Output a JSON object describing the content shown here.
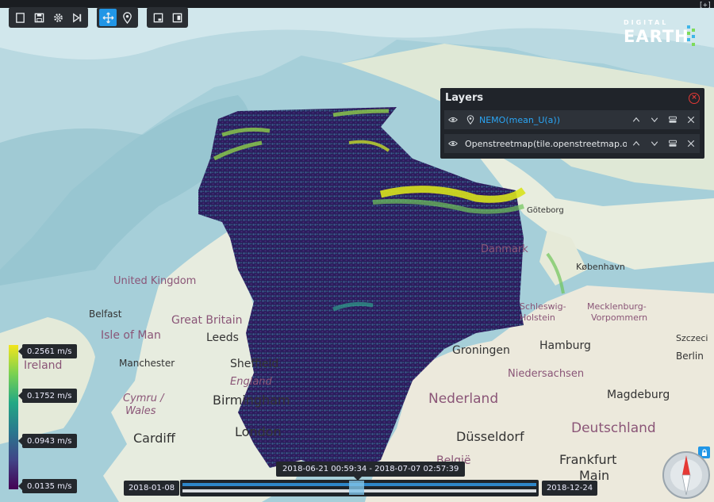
{
  "toolbar": {
    "left_group": [
      "new-file-icon",
      "save-icon",
      "settings-icon",
      "play-step-icon"
    ],
    "mid_group": [
      "pan-icon",
      "location-pin-icon"
    ],
    "right_group": [
      "window-icon",
      "window-expand-icon"
    ],
    "active": "pan-icon",
    "active_color": "#2196e6"
  },
  "brand": {
    "top": "DIGITAL",
    "main": "EARTH"
  },
  "fullscreen": "[+]",
  "layers": {
    "title": "Layers",
    "items": [
      {
        "name": "NEMO(mean_U(a))",
        "selected": true
      },
      {
        "name": "Openstreetmap(tile.openstreetmap.or",
        "selected": false
      }
    ]
  },
  "legend": {
    "values": [
      "0.2561 m/s",
      "0.1752 m/s",
      "0.0943 m/s",
      "0.0135 m/s"
    ],
    "colors": [
      "#f2e51c",
      "#22a884",
      "#414487",
      "#440154"
    ]
  },
  "time": {
    "range": "2018-06-21 00:59:34 - 2018-07-07 02:57:39",
    "start": "2018-01-08",
    "end": "2018-12-24"
  },
  "map_labels": {
    "united_kingdom": "United Kingdom",
    "great_britain": "Great Britain",
    "belfast": "Belfast",
    "isle_of_man": "Isle of Man",
    "ireland": "Ireland",
    "leeds": "Leeds",
    "manchester": "Manchester",
    "sheffield": "Sheffield",
    "england": "England",
    "birmingham": "Birmingham",
    "cymru": "Cymru /",
    "wales": "Wales",
    "cardiff": "Cardiff",
    "london": "London",
    "danmark": "Danmark",
    "kobenhavn": "København",
    "goteborg": "Göteborg",
    "schleswig": "Schleswig-",
    "holstein": "Holstein",
    "mecklenburg": "Mecklenburg-",
    "vorpommern": "Vorpommern",
    "groningen": "Groningen",
    "hamburg": "Hamburg",
    "berlin": "Berlin",
    "szczecin": "Szczeci",
    "niedersachsen": "Niedersachsen",
    "nederland": "Nederland",
    "magdeburg": "Magdeburg",
    "deutschland": "Deutschland",
    "dusseldorf": "Düsseldorf",
    "frankfurt": "Frankfurt",
    "main": "Main",
    "belgie": "België"
  }
}
